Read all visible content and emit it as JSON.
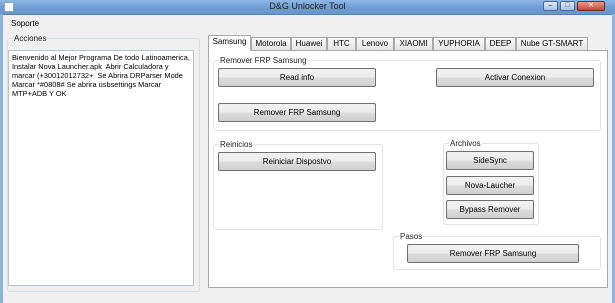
{
  "window": {
    "title": "D&G Unlocker Tool"
  },
  "menu": {
    "item": "Soporte"
  },
  "acciones": {
    "legend": "Acciones",
    "text": "Bienvenido al Mejor Programa De todo Latinoamerica, Instalar Nova Launcher.apk  Abrir Calculadora y marcar (+30012012732+  Se Abrira DRParser Mode Marcar *#0808# Se abrira usbsettings Marcar MTP+ADB Y OK"
  },
  "tabs": [
    "Samsung",
    "Motorola",
    "Huawei",
    "HTC",
    "Lenovo",
    "XIAOMI",
    "YUPHORIA",
    "DEEP",
    "Nube GT-SMART"
  ],
  "frp_group": {
    "legend": "Remover FRP Samsung",
    "read_info": "Read info",
    "activar": "Activar Conexion",
    "remover": "Remover FRP Samsung"
  },
  "reinicios": {
    "legend": "Reinicios",
    "reiniciar": "Reiniciar Dispostvo"
  },
  "archivos": {
    "legend": "Archivos",
    "sidesync": "SideSync",
    "nova": "Nova-Laucher",
    "bypass": "Bypass Remover"
  },
  "pasos": {
    "legend": "Pasos",
    "remover": "Remover FRP Samsung"
  }
}
